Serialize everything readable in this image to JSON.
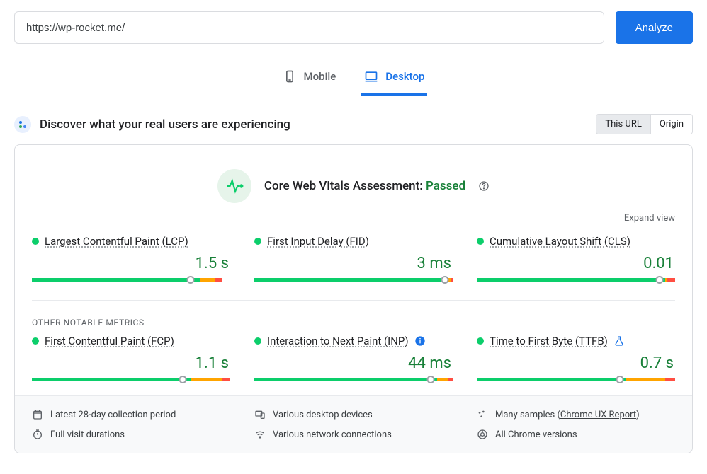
{
  "url_value": "https://wp-rocket.me/",
  "analyze_label": "Analyze",
  "tabs": {
    "mobile": "Mobile",
    "desktop": "Desktop"
  },
  "section_title": "Discover what your real users are experiencing",
  "seg": {
    "url": "This URL",
    "origin": "Origin"
  },
  "assessment": {
    "prefix": "Core Web Vitals Assessment: ",
    "status": "Passed"
  },
  "expand_label": "Expand view",
  "other_header": "OTHER NOTABLE METRICS",
  "metrics": {
    "lcp": {
      "label": "Largest Contentful Paint (LCP)",
      "value": "1.5 s",
      "bar": {
        "g": 85,
        "o": 7,
        "r": 4
      },
      "marker": 80
    },
    "fid": {
      "label": "First Input Delay (FID)",
      "value": "3 ms",
      "bar": {
        "g": 97,
        "o": 2,
        "r": 1
      },
      "marker": 96
    },
    "cls": {
      "label": "Cumulative Layout Shift (CLS)",
      "value": "0.01",
      "bar": {
        "g": 95,
        "o": 1,
        "r": 4
      },
      "marker": 92
    },
    "fcp": {
      "label": "First Contentful Paint (FCP)",
      "value": "1.1 s",
      "bar": {
        "g": 80,
        "o": 16,
        "r": 4
      },
      "marker": 76
    },
    "inp": {
      "label": "Interaction to Next Paint (INP)",
      "value": "44 ms",
      "bar": {
        "g": 92,
        "o": 6,
        "r": 2
      },
      "marker": 89
    },
    "ttfb": {
      "label": "Time to First Byte (TTFB)",
      "value": "0.7 s",
      "bar": {
        "g": 75,
        "o": 20,
        "r": 5
      },
      "marker": 72
    }
  },
  "footer": {
    "period": "Latest 28-day collection period",
    "devices": "Various desktop devices",
    "samples_prefix": "Many samples (",
    "samples_link": "Chrome UX Report",
    "samples_suffix": ")",
    "duration": "Full visit durations",
    "network": "Various network connections",
    "versions": "All Chrome versions"
  }
}
